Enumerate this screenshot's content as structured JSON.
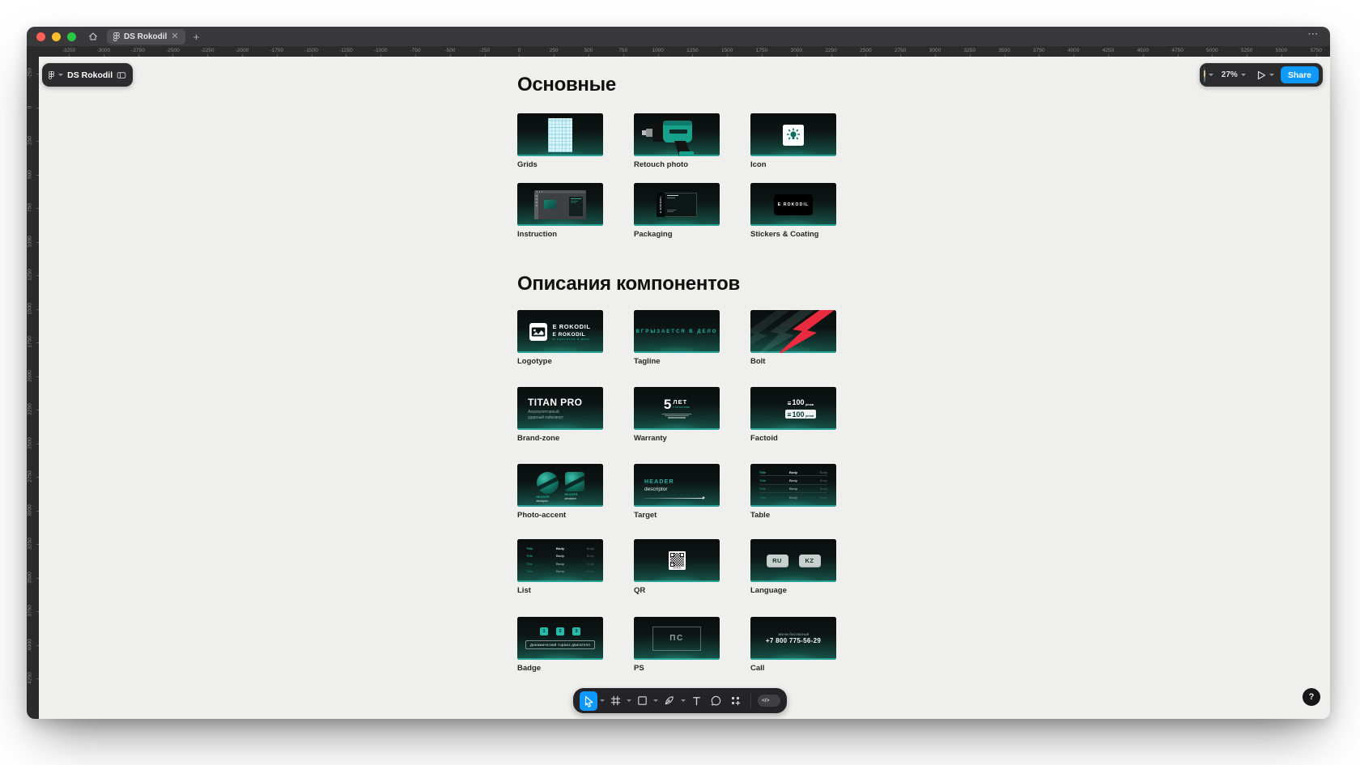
{
  "titlebar": {
    "active_tab": "DS Rokodil",
    "overflow": "···"
  },
  "left_toolbar": {
    "file_name": "DS Rokodil"
  },
  "right_toolbar": {
    "zoom": "27%",
    "share": "Share"
  },
  "rulers": {
    "top_labels": [
      -3250,
      -3000,
      -2750,
      -2500,
      -2250,
      -2000,
      -1750,
      -1500,
      -1250,
      -1000,
      -750,
      -500,
      -250,
      0,
      250,
      500,
      750,
      1000,
      1250,
      1500,
      1750,
      2000,
      2250,
      2500,
      2750,
      3000,
      3250,
      3500,
      3750,
      4000,
      4250,
      4500,
      4750,
      5000,
      5250,
      5500,
      5750
    ],
    "left_labels": [
      -250,
      0,
      250,
      500,
      750,
      1000,
      1250,
      1500,
      1750,
      2000,
      2250,
      2500,
      2750,
      3000,
      3250,
      3500,
      3750,
      4000,
      4250
    ]
  },
  "canvas": {
    "sections": [
      {
        "title": "Основные",
        "cards": [
          {
            "type": "grids",
            "label": "Grids"
          },
          {
            "type": "retouch",
            "label": "Retouch photo"
          },
          {
            "type": "icon",
            "label": "Icon"
          },
          {
            "type": "instruction",
            "label": "Instruction"
          },
          {
            "type": "packaging",
            "label": "Packaging",
            "spine_text": "E ROKODIL"
          },
          {
            "type": "stickers",
            "label": "Stickers & Coating",
            "text": "E ROKODIL"
          }
        ]
      },
      {
        "title": "Описания компонентов",
        "cards": [
          {
            "type": "logotype",
            "label": "Logotype",
            "brand": "E ROKODIL",
            "brand2": "E ROKODIL",
            "tagline": "ВГРЫЗАЕТСЯ В ДЕЛО"
          },
          {
            "type": "tagline",
            "label": "Tagline",
            "text": "ВГРЫЗАЕТСЯ В ДЕЛО"
          },
          {
            "type": "bolt",
            "label": "Bolt"
          },
          {
            "type": "brandzone",
            "label": "Brand-zone",
            "title": "TITAN PRO",
            "subtitle1": "Аккумуляторный",
            "subtitle2": "ударный гайковерт"
          },
          {
            "type": "warranty",
            "label": "Warranty",
            "big": "5",
            "unit": "ЛЕТ",
            "sub": "ГАРАНТИЯ"
          },
          {
            "type": "factoid",
            "label": "Factoid",
            "value": "100",
            "unit": "резов"
          },
          {
            "type": "photoaccent",
            "label": "Photo-accent",
            "header": "HEADER",
            "descriptor": "descriptor"
          },
          {
            "type": "target",
            "label": "Target",
            "header": "HEADER",
            "descriptor": "descriptor"
          },
          {
            "type": "table",
            "label": "Table",
            "col_title": "Title",
            "col_body": "Body"
          },
          {
            "type": "list",
            "label": "List",
            "col_title": "Title",
            "col_body": "Body"
          },
          {
            "type": "qr",
            "label": "QR",
            "caption": "rokodil.ru"
          },
          {
            "type": "language",
            "label": "Language",
            "options": [
              "RU",
              "KZ"
            ]
          },
          {
            "type": "badge",
            "label": "Badge",
            "numbers": [
              "1",
              "2",
              "3"
            ],
            "text": "Динамический тормоз двигателя"
          },
          {
            "type": "ps",
            "label": "PS",
            "text": "ПС"
          },
          {
            "type": "call",
            "label": "Call",
            "note": "звонок бесплатный",
            "phone": "+7 800 775-56-29"
          }
        ]
      }
    ]
  },
  "bottom_toolbar": {
    "dev_mode": "</>"
  },
  "help": {
    "label": "?"
  }
}
